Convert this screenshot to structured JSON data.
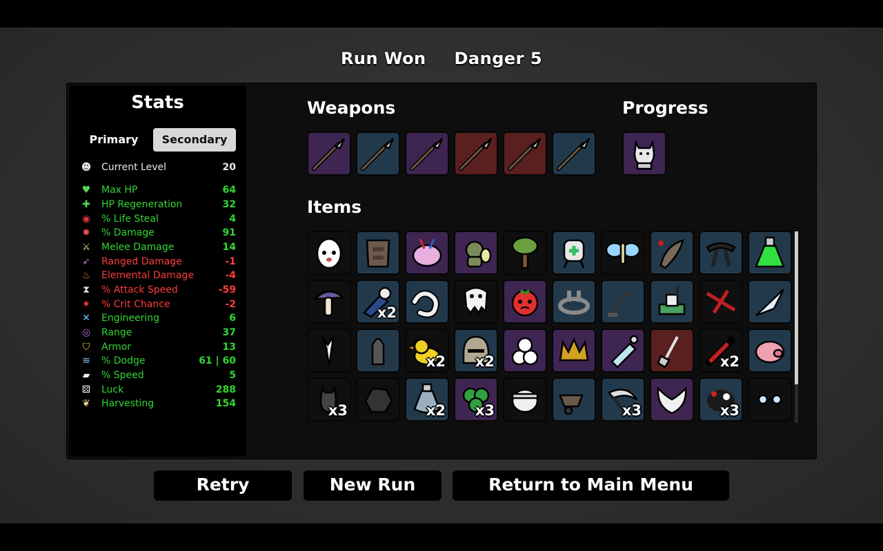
{
  "header": {
    "result": "Run Won",
    "danger": "Danger 5"
  },
  "stats": {
    "title": "Stats",
    "tabs": {
      "primary": "Primary",
      "secondary": "Secondary"
    },
    "level": {
      "label": "Current Level",
      "value": "20"
    },
    "rows": [
      {
        "label": "Max HP",
        "value": "64",
        "tone": "pos",
        "icon": "heart-icon",
        "glyph": "♥",
        "color": "#5ad65a"
      },
      {
        "label": "HP Regeneration",
        "value": "32",
        "tone": "pos",
        "icon": "hp-regen-icon",
        "glyph": "✚",
        "color": "#5ad65a"
      },
      {
        "label": "% Life Steal",
        "value": "4",
        "tone": "pos",
        "icon": "life-steal-icon",
        "glyph": "◉",
        "color": "#d23a3a"
      },
      {
        "label": "% Damage",
        "value": "91",
        "tone": "pos",
        "icon": "damage-icon",
        "glyph": "✹",
        "color": "#e05050"
      },
      {
        "label": "Melee Damage",
        "value": "14",
        "tone": "pos",
        "icon": "sword-icon",
        "glyph": "⚔",
        "color": "#e8d08a"
      },
      {
        "label": "Ranged Damage",
        "value": "-1",
        "tone": "neg",
        "icon": "bow-icon",
        "glyph": "➶",
        "color": "#c070d0"
      },
      {
        "label": "Elemental Damage",
        "value": "-4",
        "tone": "neg",
        "icon": "flame-icon",
        "glyph": "♨",
        "color": "#f08a40"
      },
      {
        "label": "% Attack Speed",
        "value": "-59",
        "tone": "neg",
        "icon": "hourglass-icon",
        "glyph": "⧗",
        "color": "#dddddd"
      },
      {
        "label": "% Crit Chance",
        "value": "-2",
        "tone": "neg",
        "icon": "crit-icon",
        "glyph": "✷",
        "color": "#e03a3a"
      },
      {
        "label": "Engineering",
        "value": "6",
        "tone": "pos",
        "icon": "wrench-icon",
        "glyph": "✕",
        "color": "#6ac8ff"
      },
      {
        "label": "Range",
        "value": "37",
        "tone": "pos",
        "icon": "range-icon",
        "glyph": "◎",
        "color": "#c070e0"
      },
      {
        "label": "Armor",
        "value": "13",
        "tone": "pos",
        "icon": "shield-icon",
        "glyph": "⛉",
        "color": "#f0d040"
      },
      {
        "label": "% Dodge",
        "value": "61 | 60",
        "tone": "pos",
        "icon": "dodge-icon",
        "glyph": "≋",
        "color": "#8ad0ff"
      },
      {
        "label": "% Speed",
        "value": "5",
        "tone": "pos",
        "icon": "speed-icon",
        "glyph": "▰",
        "color": "#eeeeee"
      },
      {
        "label": "Luck",
        "value": "288",
        "tone": "pos",
        "icon": "dice-icon",
        "glyph": "⚄",
        "color": "#ffffff"
      },
      {
        "label": "Harvesting",
        "value": "154",
        "tone": "pos",
        "icon": "wheat-icon",
        "glyph": "❦",
        "color": "#e8d08a"
      }
    ]
  },
  "weapons": {
    "title": "Weapons",
    "slots": [
      {
        "tier": 2,
        "icon": "spear-icon"
      },
      {
        "tier": 1,
        "icon": "spear-icon"
      },
      {
        "tier": 2,
        "icon": "spear-icon"
      },
      {
        "tier": 3,
        "icon": "spear-icon"
      },
      {
        "tier": 3,
        "icon": "spear-icon"
      },
      {
        "tier": 1,
        "icon": "spear-icon"
      }
    ]
  },
  "progress": {
    "title": "Progress",
    "slots": [
      {
        "tier": 2,
        "icon": "cat-statue-icon"
      }
    ]
  },
  "items": {
    "title": "Items",
    "slots": [
      {
        "tier": 0,
        "icon": "egg-face-icon",
        "count": ""
      },
      {
        "tier": 1,
        "icon": "tattered-vest-icon",
        "count": ""
      },
      {
        "tier": 2,
        "icon": "pink-brain-icon",
        "count": ""
      },
      {
        "tier": 2,
        "icon": "green-creature-icon",
        "count": ""
      },
      {
        "tier": 0,
        "icon": "tree-icon",
        "count": ""
      },
      {
        "tier": 1,
        "icon": "medkit-robot-icon",
        "count": ""
      },
      {
        "tier": 0,
        "icon": "blue-butterfly-icon",
        "count": ""
      },
      {
        "tier": 1,
        "icon": "claw-tail-icon",
        "count": ""
      },
      {
        "tier": 1,
        "icon": "black-belt-icon",
        "count": ""
      },
      {
        "tier": 1,
        "icon": "green-potion-icon",
        "count": ""
      },
      {
        "tier": 0,
        "icon": "mushroom-icon",
        "count": ""
      },
      {
        "tier": 1,
        "icon": "skull-bird-icon",
        "count": "x2"
      },
      {
        "tier": 1,
        "icon": "worm-icon",
        "count": ""
      },
      {
        "tier": 0,
        "icon": "ghost-skull-icon",
        "count": ""
      },
      {
        "tier": 2,
        "icon": "angry-tomato-icon",
        "count": ""
      },
      {
        "tier": 1,
        "icon": "stone-circle-icon",
        "count": ""
      },
      {
        "tier": 1,
        "icon": "grabber-arm-icon",
        "count": ""
      },
      {
        "tier": 1,
        "icon": "turret-icon",
        "count": ""
      },
      {
        "tier": 0,
        "icon": "red-scar-icon",
        "count": ""
      },
      {
        "tier": 1,
        "icon": "comet-icon",
        "count": ""
      },
      {
        "tier": 0,
        "icon": "goat-skull-icon",
        "count": ""
      },
      {
        "tier": 1,
        "icon": "bullet-icon",
        "count": ""
      },
      {
        "tier": 0,
        "icon": "rubber-duck-icon",
        "count": "x2"
      },
      {
        "tier": 1,
        "icon": "knight-helmet-icon",
        "count": "x2"
      },
      {
        "tier": 2,
        "icon": "snowman-pile-icon",
        "count": ""
      },
      {
        "tier": 2,
        "icon": "spiked-crown-icon",
        "count": ""
      },
      {
        "tier": 2,
        "icon": "baby-bottle-icon",
        "count": ""
      },
      {
        "tier": 3,
        "icon": "shovel-icon",
        "count": ""
      },
      {
        "tier": 0,
        "icon": "syringe-icon",
        "count": "x2"
      },
      {
        "tier": 1,
        "icon": "piggy-bank-icon",
        "count": ""
      },
      {
        "tier": 0,
        "icon": "small-cat-icon",
        "count": "x3"
      },
      {
        "tier": 0,
        "icon": "coal-rock-icon",
        "count": ""
      },
      {
        "tier": 1,
        "icon": "potion-flask-icon",
        "count": "x2"
      },
      {
        "tier": 2,
        "icon": "clover-icon",
        "count": "x3"
      },
      {
        "tier": 0,
        "icon": "bandaged-head-icon",
        "count": ""
      },
      {
        "tier": 1,
        "icon": "wheelbarrow-icon",
        "count": ""
      },
      {
        "tier": 1,
        "icon": "scythe-icon",
        "count": "x3"
      },
      {
        "tier": 2,
        "icon": "white-wings-icon",
        "count": ""
      },
      {
        "tier": 1,
        "icon": "dark-blob-icon",
        "count": "x3"
      },
      {
        "tier": 0,
        "icon": "glasses-icon",
        "count": ""
      }
    ]
  },
  "buttons": {
    "retry": "Retry",
    "new_run": "New Run",
    "main_menu": "Return to Main Menu"
  }
}
